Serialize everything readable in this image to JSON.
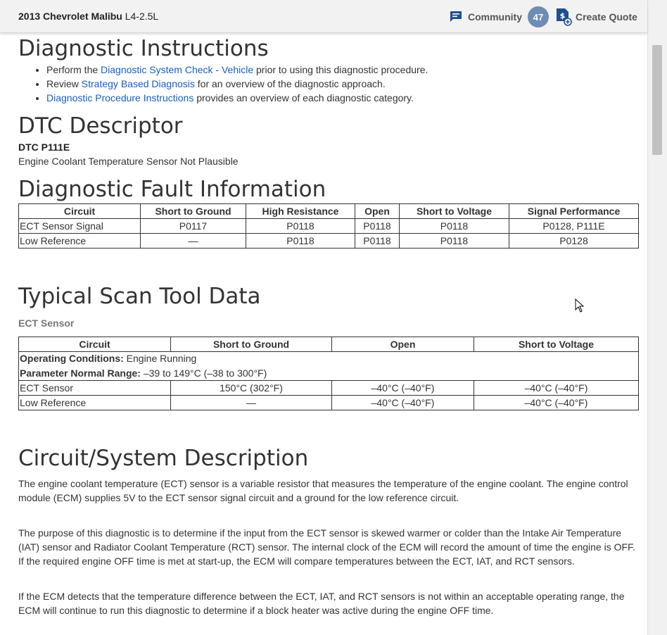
{
  "header": {
    "vehicle": "2013 Chevrolet Malibu",
    "engine": "L4-2.5L",
    "community_label": "Community",
    "community_count": "47",
    "quote_label": "Create Quote"
  },
  "diag": {
    "title": "Diagnostic Instructions",
    "b1_pre": "Perform the ",
    "b1_link": "Diagnostic System Check - Vehicle",
    "b1_post": " prior to using this diagnostic procedure.",
    "b2_pre": "Review ",
    "b2_link": "Strategy Based Diagnosis",
    "b2_post": " for an overview of the diagnostic approach.",
    "b3_link": "Diagnostic Procedure Instructions",
    "b3_post": " provides an overview of each diagnostic category."
  },
  "dtc": {
    "title": "DTC Descriptor",
    "code": "DTC P111E",
    "desc": "Engine Coolant Temperature Sensor Not Plausible"
  },
  "fault": {
    "title": "Diagnostic Fault Information",
    "headers": [
      "Circuit",
      "Short to Ground",
      "High Resistance",
      "Open",
      "Short to Voltage",
      "Signal Performance"
    ],
    "rows": [
      [
        "ECT Sensor Signal",
        "P0117",
        "P0118",
        "P0118",
        "P0118",
        "P0128, P111E"
      ],
      [
        "Low Reference",
        "—",
        "P0118",
        "P0118",
        "P0118",
        "P0128"
      ]
    ]
  },
  "scan": {
    "title": "Typical Scan Tool Data",
    "subtitle": "ECT Sensor",
    "headers": [
      "Circuit",
      "Short to Ground",
      "Open",
      "Short to Voltage"
    ],
    "cond_label": "Operating Conditions:",
    "cond_value": " Engine Running",
    "range_label": "Parameter Normal Range:",
    "range_value": " –39 to 149°C (–38 to 300°F)",
    "rows": [
      [
        "ECT Sensor",
        "150°C (302°F)",
        "–40°C (–40°F)",
        "–40°C (–40°F)"
      ],
      [
        "Low Reference",
        "—",
        "–40°C (–40°F)",
        "–40°C (–40°F)"
      ]
    ]
  },
  "circuit": {
    "title": "Circuit/System Description",
    "p1": "The engine coolant temperature (ECT) sensor is a variable resistor that measures the temperature of the engine coolant. The engine control module (ECM) supplies 5V to the ECT sensor signal circuit and a ground for the low reference circuit.",
    "p2": "The purpose of this diagnostic is to determine if the input from the ECT sensor is skewed warmer or colder than the Intake Air Temperature (IAT) sensor and Radiator Coolant Temperature (RCT) sensor. The internal clock of the ECM will record the amount of time the engine is OFF. If the required engine OFF time is met at start-up, the ECM will compare temperatures between the ECT, IAT, and RCT sensors.",
    "p3": "If the ECM detects that the temperature difference between the ECT, IAT, and RCT sensors is not within an acceptable operating range, the ECM will continue to run this diagnostic to determine if a block heater was active during the engine OFF time."
  },
  "colors": {
    "link": "#1a5ec1",
    "badge": "#6d8db5",
    "icon": "#1e4f8c"
  }
}
